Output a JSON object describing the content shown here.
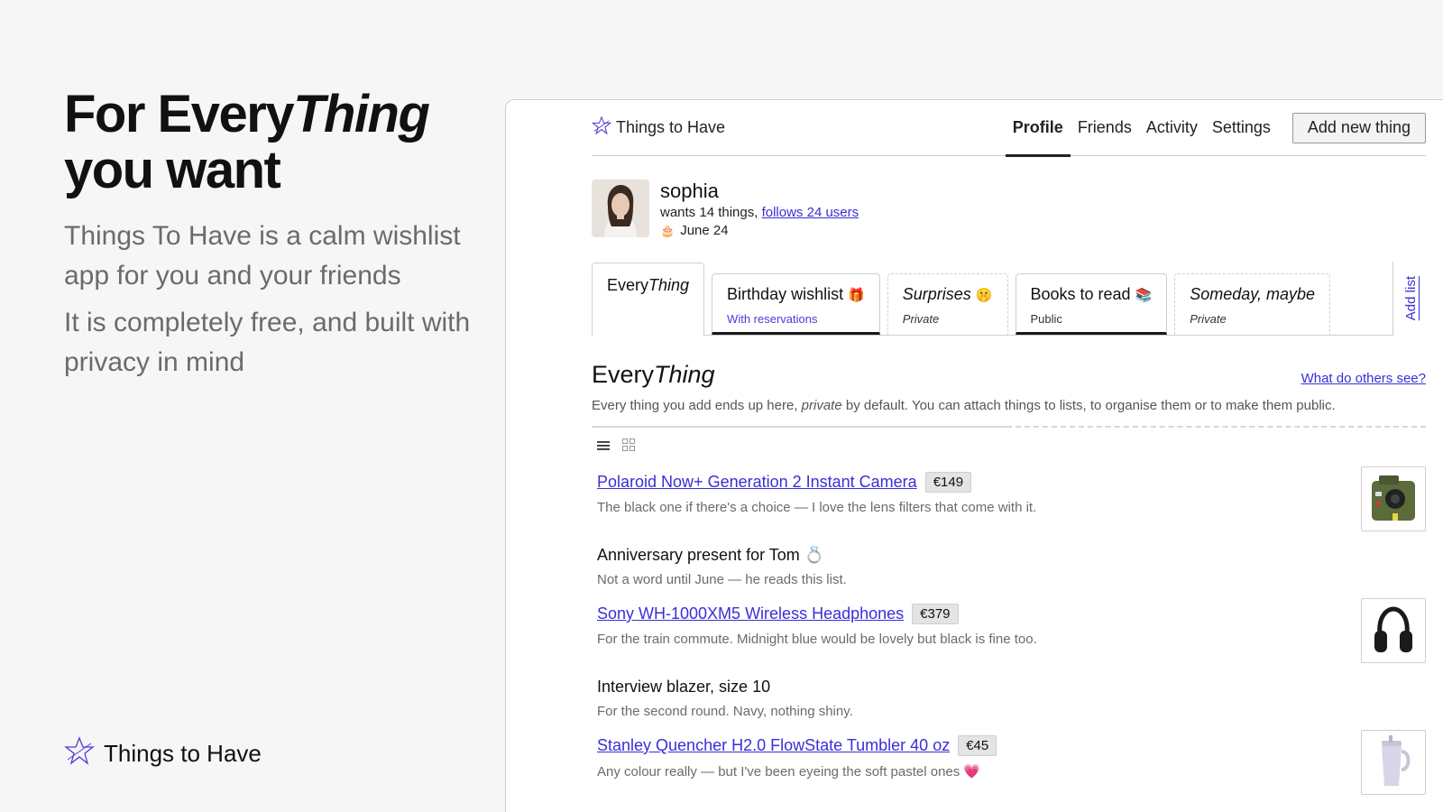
{
  "hero": {
    "title_line1_a": "For Every",
    "title_line1_b": "Thing",
    "title_line2": "you want",
    "para1": "Things To Have is a calm wishlist app for you and your friends",
    "para2": "It is completely free, and built with privacy in mind"
  },
  "brand": {
    "name": "Things to Have",
    "icon": "star-outline-icon",
    "accent": "#4b3bd8"
  },
  "nav": {
    "links": [
      "Profile",
      "Friends",
      "Activity",
      "Settings"
    ],
    "active": "Profile",
    "add_button": "Add new thing"
  },
  "profile": {
    "username": "sophia",
    "wants_text": "wants 14 things, ",
    "follows_link": "follows 24 users",
    "birthday_icon": "cake-icon",
    "birthday": "June 24"
  },
  "tabs": [
    {
      "name_a": "Every",
      "name_b": "Thing",
      "sub": ""
    },
    {
      "name": "Birthday wishlist",
      "emoji": "🎁",
      "sub": "With reservations"
    },
    {
      "name": "Surprises",
      "emoji": "🤫",
      "sub": "Private"
    },
    {
      "name": "Books to read",
      "emoji": "📚",
      "sub": "Public"
    },
    {
      "name": "Someday, maybe",
      "emoji": "",
      "sub": "Private"
    }
  ],
  "add_list": "Add list",
  "section": {
    "title_a": "Every",
    "title_b": "Thing",
    "link": "What do others see?",
    "desc_a": "Every thing you add ends up here, ",
    "desc_b": "private",
    "desc_c": " by default. You can attach things to lists, to organise them or to make them public."
  },
  "view_toggle": {
    "list_icon": "list-view-icon",
    "grid_icon": "grid-view-icon"
  },
  "items": [
    {
      "title": "Polaroid Now+ Generation 2 Instant Camera",
      "price": "€149",
      "desc": "The black one if there's a choice — I love the lens filters that come with it.",
      "thumb": "camera-icon"
    },
    {
      "title": "Anniversary present for Tom 💍",
      "price": "",
      "desc": "Not a word until June — he reads this list."
    },
    {
      "title": "Sony WH-1000XM5 Wireless Headphones",
      "price": "€379",
      "desc": "For the train commute. Midnight blue would be lovely but black is fine too.",
      "thumb": "headphones-icon"
    },
    {
      "title": "Interview blazer, size 10",
      "price": "",
      "desc": "For the second round. Navy, nothing shiny."
    },
    {
      "title": "Stanley Quencher H2.0 FlowState Tumbler 40 oz",
      "price": "€45",
      "desc": "Any colour really — but I've been eyeing the soft pastel ones 💗",
      "thumb": "tumbler-icon"
    }
  ]
}
